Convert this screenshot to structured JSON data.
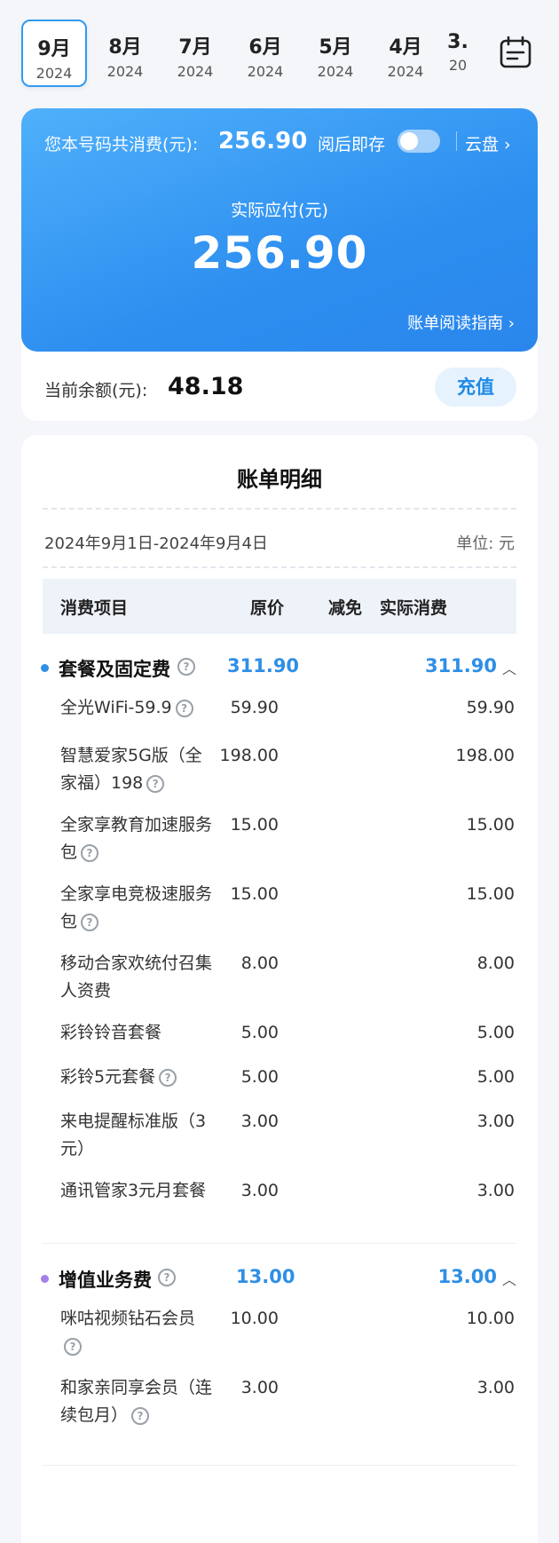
{
  "months": [
    {
      "month": "9月",
      "year": "2024"
    },
    {
      "month": "8月",
      "year": "2024"
    },
    {
      "month": "7月",
      "year": "2024"
    },
    {
      "month": "6月",
      "year": "2024"
    },
    {
      "month": "5月",
      "year": "2024"
    },
    {
      "month": "4月",
      "year": "2024"
    },
    {
      "month": "3.",
      "year": "20"
    }
  ],
  "summary": {
    "total_label": "您本号码共消费(元):",
    "total_value": "256.90",
    "save_label": "阅后即存",
    "cloud_label": "云盘 ›",
    "due_label": "实际应付(元)",
    "due_value": "256.90",
    "guide_label": "账单阅读指南 ›",
    "balance_label": "当前余额(元):",
    "balance_value": "48.18",
    "recharge_label": "充值"
  },
  "detail": {
    "title": "账单明细",
    "period": "2024年9月1日-2024年9月4日",
    "unit": "单位: 元",
    "headers": {
      "item": "消费项目",
      "orig": "原价",
      "discount": "减免",
      "actual": "实际消费"
    }
  },
  "sections": [
    {
      "name": "套餐及固定费",
      "orig": "311.90",
      "actual": "311.90",
      "rows": [
        {
          "name": "全光WiFi-59.9",
          "orig": "59.90",
          "actual": "59.90"
        },
        {
          "name": "智慧爱家5G版（全家福）198",
          "orig": "198.00",
          "actual": "198.00"
        },
        {
          "name": "全家享教育加速服务包",
          "orig": "15.00",
          "actual": "15.00"
        },
        {
          "name": "全家享电竞极速服务包",
          "orig": "15.00",
          "actual": "15.00"
        },
        {
          "name": "移动合家欢统付召集人资费",
          "orig": "8.00",
          "actual": "8.00"
        },
        {
          "name": "彩铃铃音套餐",
          "orig": "5.00",
          "actual": "5.00"
        },
        {
          "name": "彩铃5元套餐",
          "orig": "5.00",
          "actual": "5.00"
        },
        {
          "name": "来电提醒标准版（3元）",
          "orig": "3.00",
          "actual": "3.00"
        },
        {
          "name": "通讯管家3元月套餐",
          "orig": "3.00",
          "actual": "3.00"
        }
      ]
    },
    {
      "name": "增值业务费",
      "orig": "13.00",
      "actual": "13.00",
      "rows": [
        {
          "name": "咪咕视频钻石会员",
          "orig": "10.00",
          "actual": "10.00"
        },
        {
          "name": "和家亲同享会员（连续包月）",
          "orig": "3.00",
          "actual": "3.00"
        }
      ]
    }
  ],
  "colors": {
    "accent": "#2f8fe6",
    "section1_dot": "#2f8fe6",
    "section2_dot": "#a57fe8"
  }
}
